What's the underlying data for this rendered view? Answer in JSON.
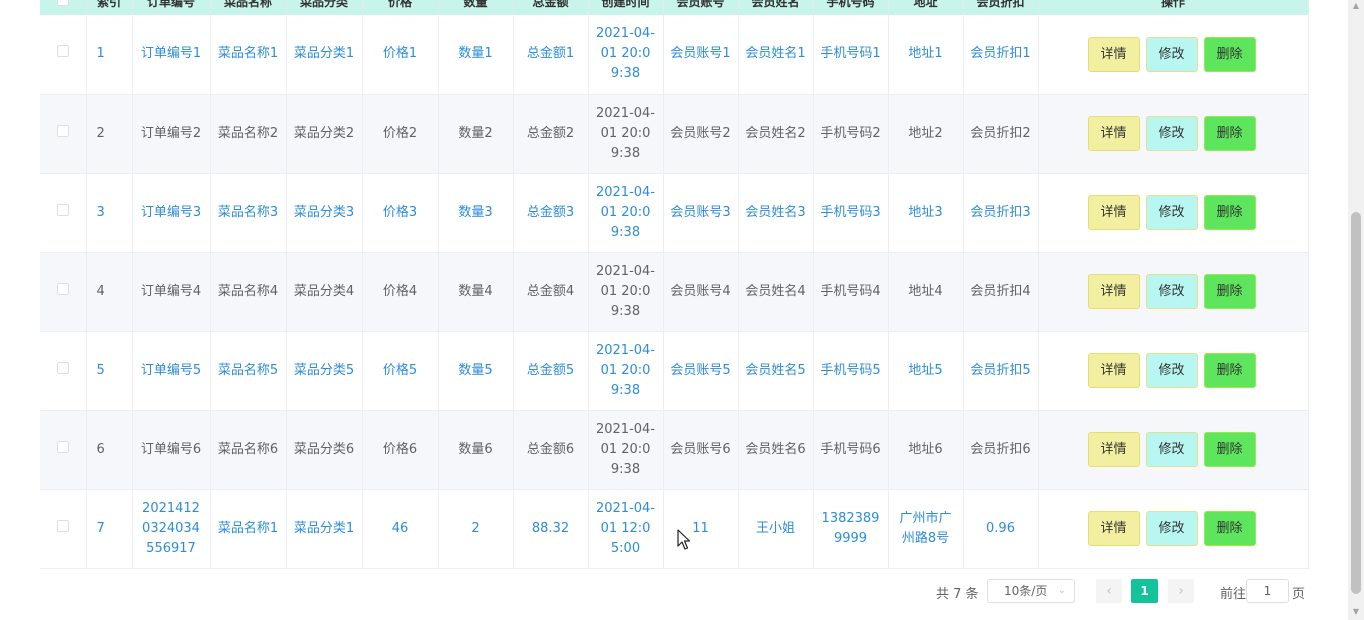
{
  "table": {
    "columns": [
      "",
      "索引",
      "订单编号",
      "菜品名称",
      "菜品分类",
      "价格",
      "数量",
      "总金额",
      "创建时间",
      "会员账号",
      "会员姓名",
      "手机号码",
      "地址",
      "会员折扣",
      "操作"
    ],
    "rows": [
      {
        "index": "1",
        "order_no": "订单编号1",
        "dish_name": "菜品名称1",
        "dish_category": "菜品分类1",
        "price": "价格1",
        "qty": "数量1",
        "total": "总金额1",
        "created": "2021-04-01 20:09:38",
        "member_account": "会员账号1",
        "member_name": "会员姓名1",
        "phone": "手机号码1",
        "address": "地址1",
        "discount": "会员折扣1"
      },
      {
        "index": "2",
        "order_no": "订单编号2",
        "dish_name": "菜品名称2",
        "dish_category": "菜品分类2",
        "price": "价格2",
        "qty": "数量2",
        "total": "总金额2",
        "created": "2021-04-01 20:09:38",
        "member_account": "会员账号2",
        "member_name": "会员姓名2",
        "phone": "手机号码2",
        "address": "地址2",
        "discount": "会员折扣2"
      },
      {
        "index": "3",
        "order_no": "订单编号3",
        "dish_name": "菜品名称3",
        "dish_category": "菜品分类3",
        "price": "价格3",
        "qty": "数量3",
        "total": "总金额3",
        "created": "2021-04-01 20:09:38",
        "member_account": "会员账号3",
        "member_name": "会员姓名3",
        "phone": "手机号码3",
        "address": "地址3",
        "discount": "会员折扣3"
      },
      {
        "index": "4",
        "order_no": "订单编号4",
        "dish_name": "菜品名称4",
        "dish_category": "菜品分类4",
        "price": "价格4",
        "qty": "数量4",
        "total": "总金额4",
        "created": "2021-04-01 20:09:38",
        "member_account": "会员账号4",
        "member_name": "会员姓名4",
        "phone": "手机号码4",
        "address": "地址4",
        "discount": "会员折扣4"
      },
      {
        "index": "5",
        "order_no": "订单编号5",
        "dish_name": "菜品名称5",
        "dish_category": "菜品分类5",
        "price": "价格5",
        "qty": "数量5",
        "total": "总金额5",
        "created": "2021-04-01 20:09:38",
        "member_account": "会员账号5",
        "member_name": "会员姓名5",
        "phone": "手机号码5",
        "address": "地址5",
        "discount": "会员折扣5"
      },
      {
        "index": "6",
        "order_no": "订单编号6",
        "dish_name": "菜品名称6",
        "dish_category": "菜品分类6",
        "price": "价格6",
        "qty": "数量6",
        "total": "总金额6",
        "created": "2021-04-01 20:09:38",
        "member_account": "会员账号6",
        "member_name": "会员姓名6",
        "phone": "手机号码6",
        "address": "地址6",
        "discount": "会员折扣6"
      },
      {
        "index": "7",
        "order_no": "20214120324034556917",
        "dish_name": "菜品名称1",
        "dish_category": "菜品分类1",
        "price": "46",
        "qty": "2",
        "total": "88.32",
        "created": "2021-04-01 12:05:00",
        "member_account": "11",
        "member_name": "王小姐",
        "phone": "13823899999",
        "address": "广州市广州路8号",
        "discount": "0.96"
      }
    ],
    "actions": {
      "detail": "详情",
      "edit": "修改",
      "delete": "删除"
    }
  },
  "pagination": {
    "total": "共 7 条",
    "page_size": "10条/页",
    "current_page": "1",
    "goto_label": "前往",
    "goto_value": "1",
    "page_unit": "页"
  },
  "colors": {
    "header_bg": "#c7f5ec",
    "link_text": "#2d8cd8",
    "detail_btn": "#f2f0a0",
    "edit_btn": "#b8f6f1",
    "delete_btn": "#5de65d",
    "active_page": "#15c39a"
  },
  "icons": {
    "prev": "chevron-left-icon",
    "next": "chevron-right-icon",
    "select": "chevron-down-icon",
    "cursor": "mouse-pointer-icon"
  }
}
